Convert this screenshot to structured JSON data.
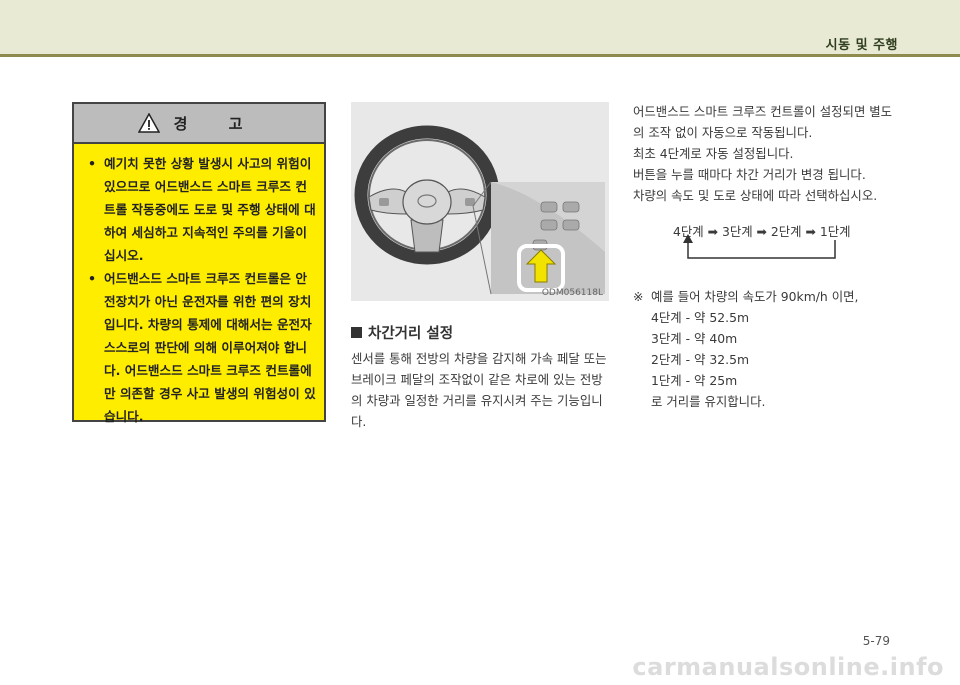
{
  "header": {
    "section_title": "시동 및 주행"
  },
  "warning": {
    "title": "경 고",
    "items": [
      "예기치 못한 상황 발생시 사고의 위험이 있으므로 어드밴스드 스마트 크루즈 컨트롤 작동중에도 도로 및 주행 상태에 대하여 세심하고 지속적인 주의를 기울이십시오.",
      "어드밴스드 스마트 크루즈 컨트롤은 안전장치가 아닌 운전자를 위한 편의 장치입니다. 차량의 통제에 대해서는 운전자 스스로의 판단에 의해 이루어져야 합니다. 어드밴스드 스마트 크루즈 컨트롤에만 의존할 경우 사고 발생의 위험성이 있습니다."
    ]
  },
  "figure": {
    "code": "ODM056118L"
  },
  "distance_section": {
    "heading": "차간거리 설정",
    "body": "센서를 통해 전방의 차량을 감지해 가속 페달 또는 브레이크 페달의 조작없이 같은 차로에 있는 전방의 차량과 일정한 거리를 유지시켜 주는 기능입니다."
  },
  "right": {
    "paragraph": "어드밴스드 스마트 크루즈 컨트롤이 설정되면 별도의 조작 없이 자동으로 작동됩니다.",
    "line2": "최초 4단계로 자동 설정됩니다.",
    "line3": "버튼을 누를 때마다 차간 거리가 변경 됩니다.",
    "line4": "차량의 속도 및 도로 상태에 따라 선택하십시오.",
    "steps": "4단계 ➡ 3단계 ➡ 2단계 ➡ 1단계",
    "example_mark": "※",
    "example_intro": "예를 들어 차량의 속도가 90km/h 이면,",
    "example_lines": [
      "4단계 - 약 52.5m",
      "3단계 - 약 40m",
      "2단계 - 약 32.5m",
      "1단계 - 약 25m",
      "로 거리를 유지합니다."
    ]
  },
  "footer": {
    "page_number": "5-79",
    "watermark": "carmanualsonline.info"
  },
  "colors": {
    "warning_bg": "#ffed00",
    "header_band": "#e9ead4",
    "header_line": "#8f8a4e",
    "arrow": "#f2e200"
  }
}
